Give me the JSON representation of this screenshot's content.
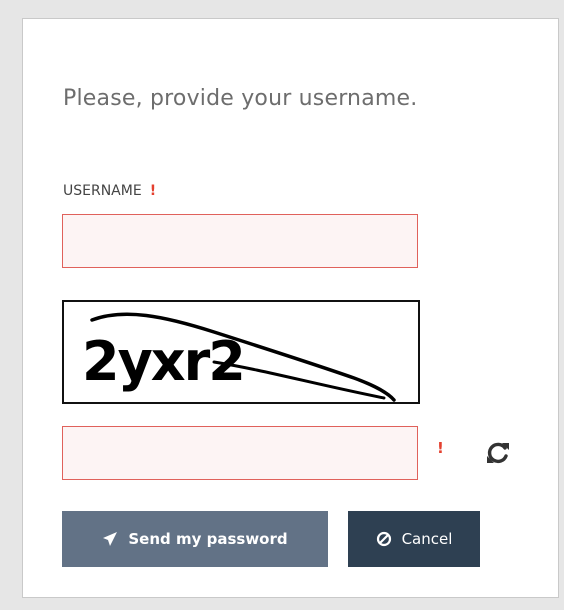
{
  "form": {
    "title": "Please, provide your username.",
    "username_label": "USERNAME",
    "required_mark": "!",
    "username_value": "",
    "captcha_text": "2yxr2",
    "captcha_value": "",
    "captcha_required_mark": "!"
  },
  "buttons": {
    "send_label": "Send my password",
    "cancel_label": "Cancel"
  },
  "icons": {
    "send": "paper-plane-icon",
    "cancel": "ban-icon",
    "refresh": "refresh-icon"
  },
  "colors": {
    "send_button": "#627286",
    "cancel_button": "#2e4052",
    "error_border": "#e0615b",
    "error_background": "#fdf4f4",
    "required": "#e4402f"
  }
}
